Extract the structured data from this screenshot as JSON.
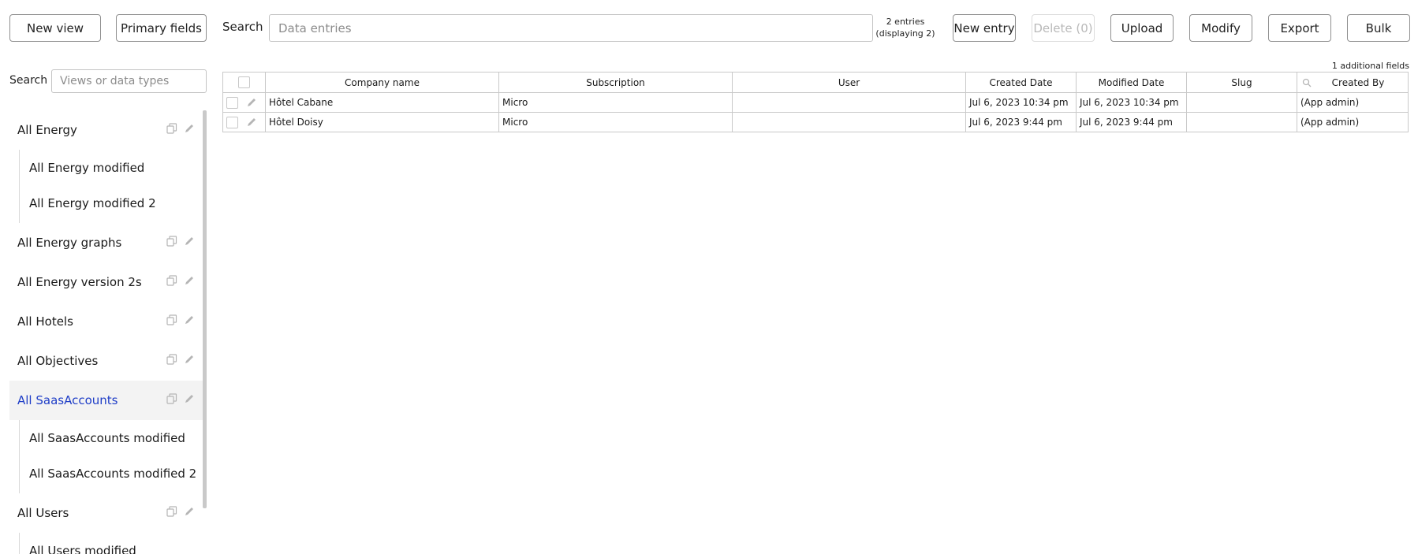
{
  "toolbar": {
    "new_view": "New view",
    "primary_fields": "Primary fields",
    "search_label": "Search",
    "search_placeholder": "Data entries",
    "entries_count": "2 entries",
    "entries_displaying": "(displaying 2)",
    "new_entry": "New entry",
    "delete": "Delete (0)",
    "upload": "Upload",
    "modify": "Modify",
    "export": "Export",
    "bulk": "Bulk"
  },
  "sidebar": {
    "search_label": "Search",
    "search_placeholder": "Views or data types",
    "views": [
      {
        "label": "All Energy",
        "children": [
          "All Energy modified",
          "All Energy modified 2"
        ]
      },
      {
        "label": "All Energy graphs",
        "children": []
      },
      {
        "label": "All Energy version 2s",
        "children": []
      },
      {
        "label": "All Hotels",
        "children": []
      },
      {
        "label": "All Objectives",
        "children": []
      },
      {
        "label": "All SaasAccounts",
        "active": true,
        "children": [
          "All SaasAccounts modified",
          "All SaasAccounts modified 2"
        ]
      },
      {
        "label": "All Users",
        "children": [
          "All Users modified"
        ]
      }
    ]
  },
  "table": {
    "additional_fields": "1 additional fields",
    "columns": [
      "Company name",
      "Subscription",
      "User",
      "Created Date",
      "Modified Date",
      "Slug",
      "Created By"
    ],
    "rows": [
      [
        "Hôtel Cabane",
        "Micro",
        "",
        "Jul 6, 2023 10:34 pm",
        "Jul 6, 2023 10:34 pm",
        "",
        "(App admin)"
      ],
      [
        "Hôtel Doisy",
        "Micro",
        "",
        "Jul 6, 2023 9:44 pm",
        "Jul 6, 2023 9:44 pm",
        "",
        "(App admin)"
      ]
    ]
  },
  "colors": {
    "active_view": "#1f3ec7",
    "border": "#8f8f8f",
    "icon": "#b5b5b5"
  },
  "icons": {
    "copy": "copy-icon",
    "edit": "pencil-icon",
    "search": "search-icon"
  }
}
